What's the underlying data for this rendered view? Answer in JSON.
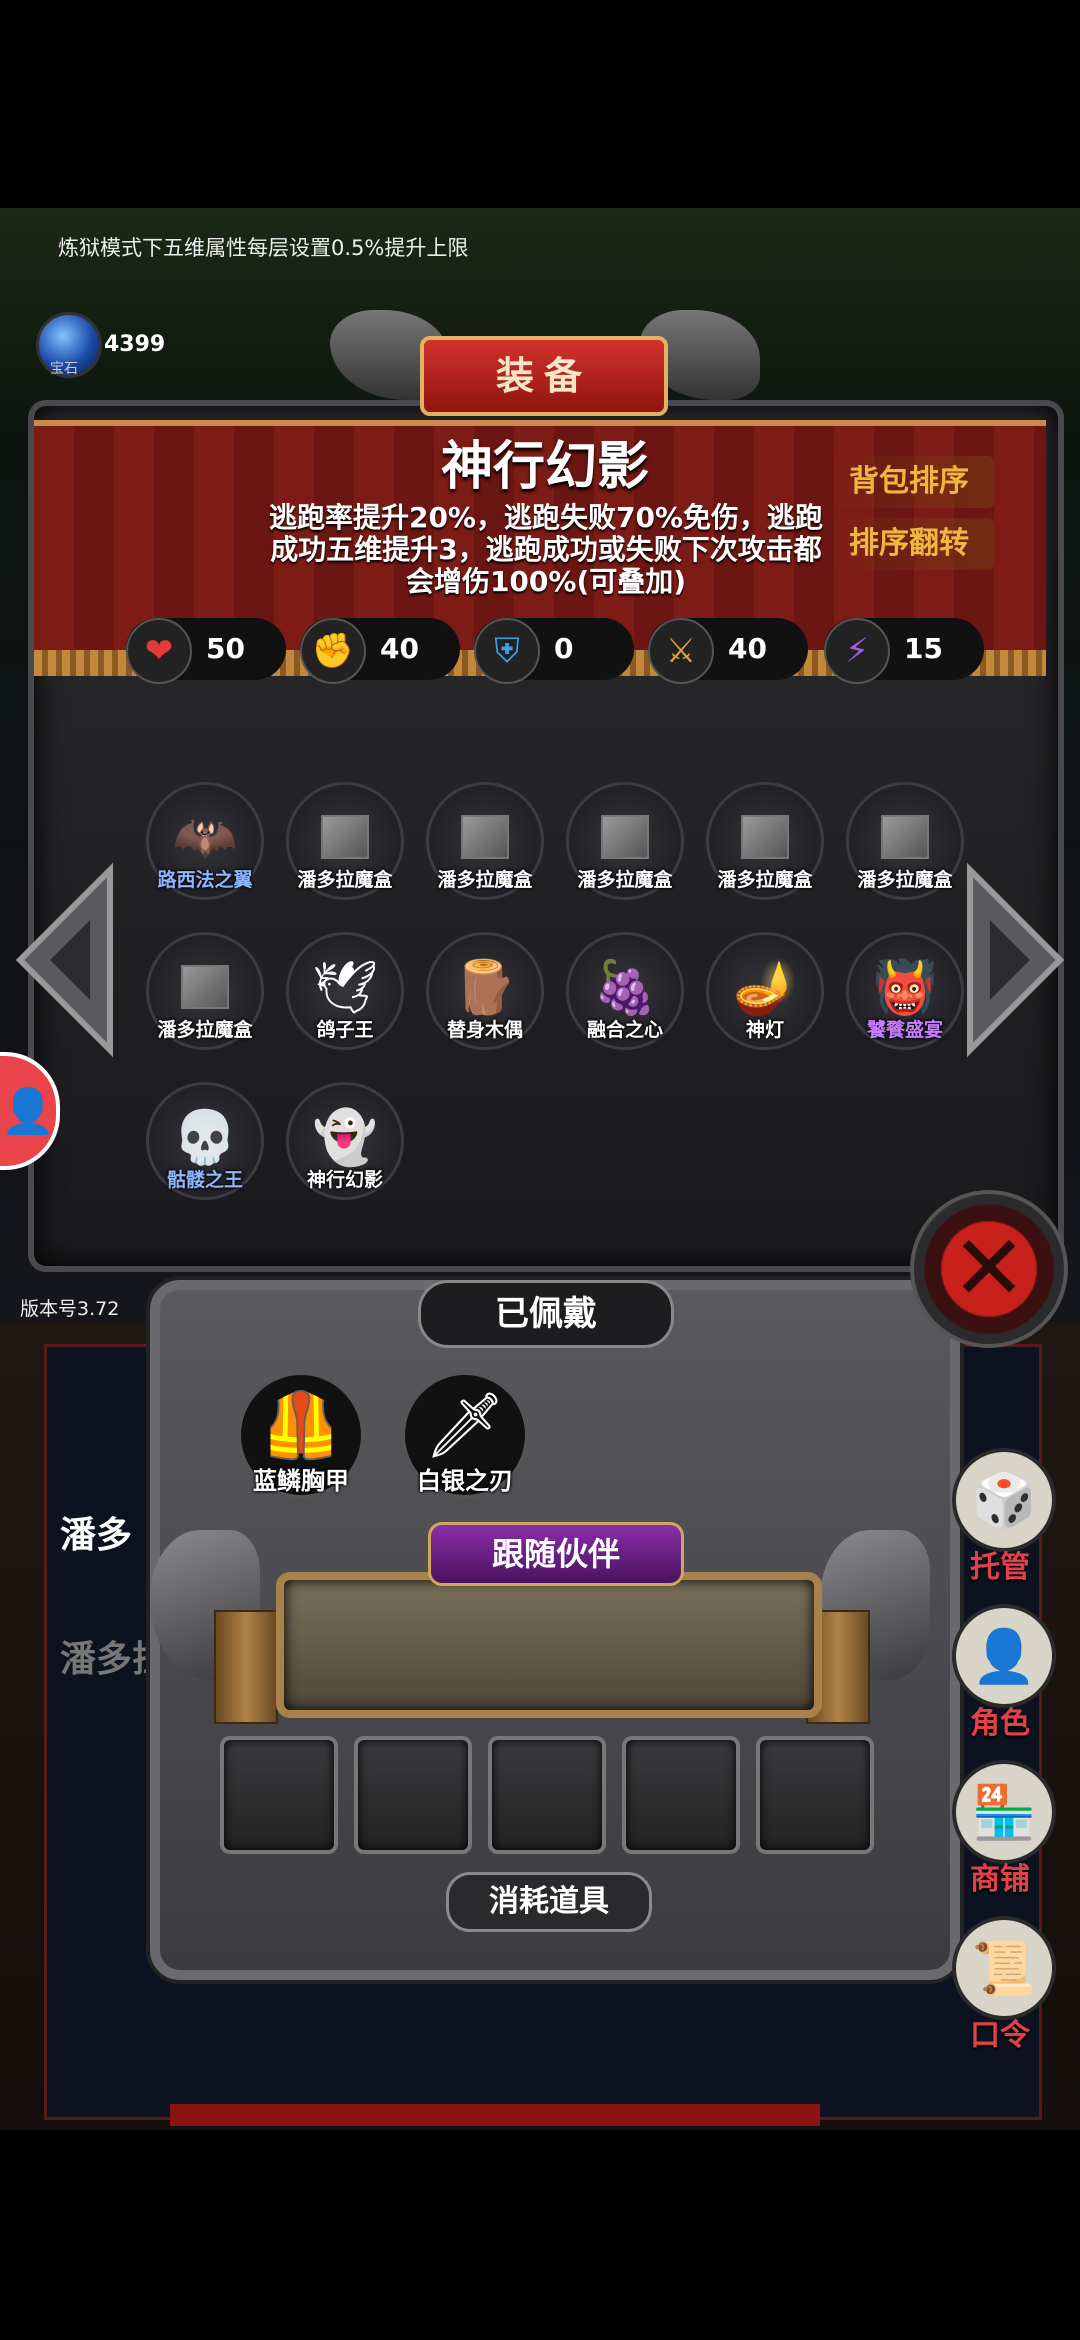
{
  "notice": "炼狱模式下五维属性每层设置0.5%提升上限",
  "gems": {
    "label": "宝石",
    "count": "4399"
  },
  "title": "装备",
  "item": {
    "name": "神行幻影",
    "description": "逃跑率提升20%，逃跑失败70%免伤，逃跑成功五维提升3，逃跑成功或失败下次攻击都会增伤100%(可叠加)"
  },
  "buttons": {
    "sort_bag": "背包排序",
    "sort_reverse": "排序翻转",
    "close": "✕"
  },
  "stats": [
    {
      "icon": "heart-icon",
      "glyph": "❤",
      "value": "50"
    },
    {
      "icon": "strength-icon",
      "glyph": "✊",
      "value": "40"
    },
    {
      "icon": "armor-icon",
      "glyph": "⛨",
      "value": "0"
    },
    {
      "icon": "weapon-icon",
      "glyph": "⚔",
      "value": "40"
    },
    {
      "icon": "lightning-icon",
      "glyph": "⚡",
      "value": "15"
    }
  ],
  "inventory": [
    {
      "name": "路西法之翼",
      "glyph": "🦇",
      "color": "#8fb7ff"
    },
    {
      "name": "潘多拉魔盒",
      "glyph": "box",
      "color": "#ffffff"
    },
    {
      "name": "潘多拉魔盒",
      "glyph": "box",
      "color": "#ffffff"
    },
    {
      "name": "潘多拉魔盒",
      "glyph": "box",
      "color": "#ffffff"
    },
    {
      "name": "潘多拉魔盒",
      "glyph": "box",
      "color": "#ffffff"
    },
    {
      "name": "潘多拉魔盒",
      "glyph": "box",
      "color": "#ffffff"
    },
    {
      "name": "潘多拉魔盒",
      "glyph": "box",
      "color": "#ffffff"
    },
    {
      "name": "鸽子王",
      "glyph": "🕊",
      "color": "#ffffff"
    },
    {
      "name": "替身木偶",
      "glyph": "🪵",
      "color": "#ffffff"
    },
    {
      "name": "融合之心",
      "glyph": "🍇",
      "color": "#ffffff"
    },
    {
      "name": "神灯",
      "glyph": "🪔",
      "color": "#ffffff"
    },
    {
      "name": "饕餮盛宴",
      "glyph": "👹",
      "color": "#c77dff"
    },
    {
      "name": "骷髅之王",
      "glyph": "💀",
      "color": "#8fb7ff"
    },
    {
      "name": "神行幻影",
      "glyph": "👻",
      "color": "#ffffff"
    }
  ],
  "equipped": {
    "title": "已佩戴",
    "items": [
      {
        "name": "蓝鳞胸甲",
        "glyph": "🦺"
      },
      {
        "name": "白银之刃",
        "glyph": "🗡"
      }
    ]
  },
  "companion": {
    "title": "跟随伙伴"
  },
  "consumables": {
    "title": "消耗道具",
    "slots": 5
  },
  "version": "版本号3.72",
  "background_text": [
    "潘多",
    "潘多拉"
  ],
  "side_menu": [
    {
      "label": "托管",
      "icon": "dice-icon",
      "glyph": "🎲"
    },
    {
      "label": "角色",
      "icon": "character-icon",
      "glyph": "👤"
    },
    {
      "label": "商铺",
      "icon": "shop-icon",
      "glyph": "🏪"
    },
    {
      "label": "口令",
      "icon": "scroll-icon",
      "glyph": "📜"
    }
  ]
}
